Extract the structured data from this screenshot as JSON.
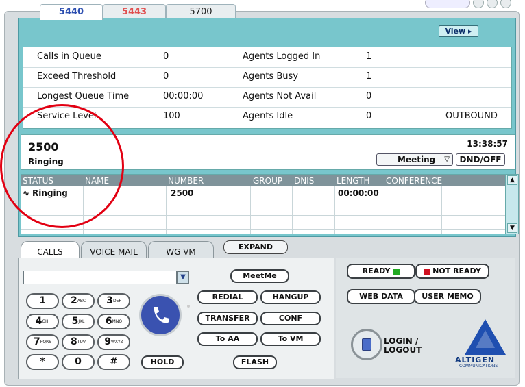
{
  "tabs": [
    {
      "label": "5440"
    },
    {
      "label": "5443"
    },
    {
      "label": "5700"
    }
  ],
  "header": {
    "view_label": "View ▸"
  },
  "stats": {
    "rows": [
      {
        "label": "Calls in Queue",
        "value": "0",
        "label2": "Agents Logged In",
        "value2": "1",
        "extra": ""
      },
      {
        "label": "Exceed Threshold",
        "value": "0",
        "label2": "Agents Busy",
        "value2": "1",
        "extra": ""
      },
      {
        "label": "Longest Queue Time",
        "value": "00:00:00",
        "label2": "Agents Not Avail",
        "value2": "0",
        "extra": ""
      },
      {
        "label": "Service Level",
        "value": "100",
        "label2": "Agents Idle",
        "value2": "0",
        "extra": "OUTBOUND"
      }
    ]
  },
  "call": {
    "number": "2500",
    "state": "Ringing",
    "time": "13:38:57",
    "meeting": "Meeting",
    "dnd": "DND/OFF"
  },
  "grid": {
    "headers": [
      "STATUS",
      "NAME",
      "NUMBER",
      "GROUP",
      "DNIS",
      "LENGTH",
      "CONFERENCE"
    ],
    "rows": [
      {
        "status": "Ringing",
        "name": "",
        "number": "2500",
        "group": "",
        "dnis": "",
        "length": "00:00:00",
        "conference": ""
      }
    ]
  },
  "bottom_tabs": [
    {
      "label": "CALLS"
    },
    {
      "label": "VOICE MAIL"
    },
    {
      "label": "WG VM"
    }
  ],
  "expand_label": "EXPAND",
  "dialpad": {
    "keys": [
      {
        "main": "1",
        "sub": ""
      },
      {
        "main": "2",
        "sub": "ABC"
      },
      {
        "main": "3",
        "sub": "DEF"
      },
      {
        "main": "4",
        "sub": "GHI"
      },
      {
        "main": "5",
        "sub": "JKL"
      },
      {
        "main": "6",
        "sub": "MNO"
      },
      {
        "main": "7",
        "sub": "PQRS"
      },
      {
        "main": "8",
        "sub": "TUV"
      },
      {
        "main": "9",
        "sub": "WXYZ"
      },
      {
        "main": "*",
        "sub": ""
      },
      {
        "main": "0",
        "sub": ""
      },
      {
        "main": "#",
        "sub": ""
      }
    ]
  },
  "actions": {
    "meetme": "MeetMe",
    "redial": "REDIAL",
    "hangup": "HANGUP",
    "transfer": "TRANSFER",
    "conf": "CONF",
    "to_aa": "To AA",
    "to_vm": "To VM",
    "hold": "HOLD",
    "flash": "FLASH"
  },
  "status_buttons": {
    "ready": "READY",
    "not_ready": "NOT READY",
    "web_data": "WEB DATA",
    "user_memo": "USER MEMO",
    "login_line1": "LOGIN /",
    "login_line2": "LOGOUT"
  },
  "logo": {
    "text": "ALTIGEN",
    "sub": "COMMUNICATIONS"
  },
  "colors": {
    "teal": "#78c6cc",
    "active_tab": "#2d4fb0",
    "red_tab": "#e05050",
    "annotation": "#e20012",
    "ready_led": "#22aa22",
    "not_ready_led": "#d01020"
  }
}
